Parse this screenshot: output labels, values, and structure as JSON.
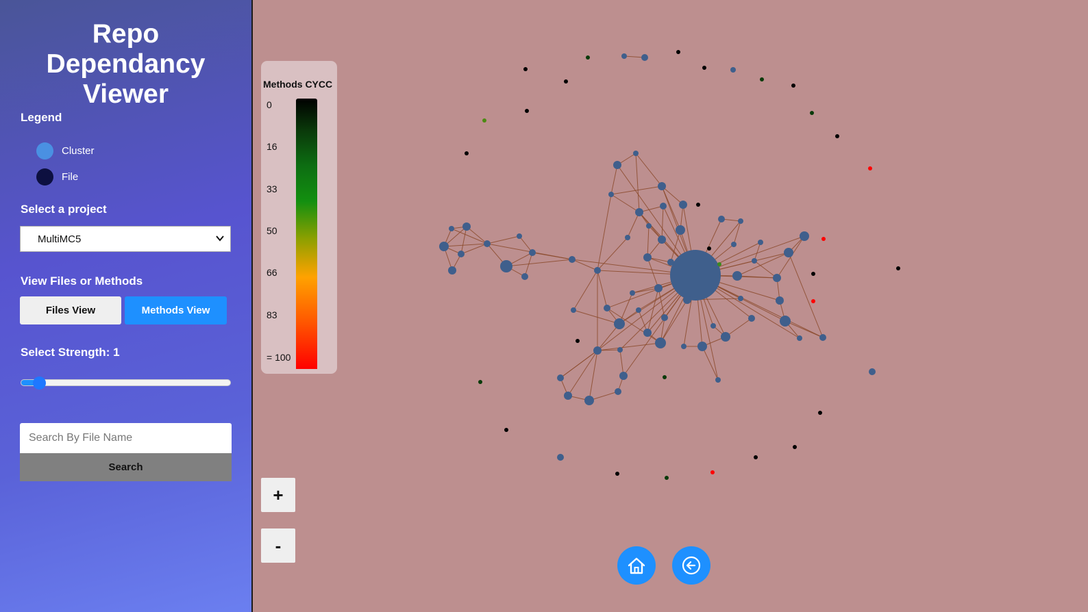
{
  "sidebar": {
    "title_lines": [
      "Repo",
      "Dependancy",
      "Viewer"
    ],
    "legend": {
      "title": "Legend",
      "items": [
        {
          "label": "Cluster",
          "color": "#4a90e2"
        },
        {
          "label": "File",
          "color": "#0d1040"
        }
      ]
    },
    "project": {
      "label": "Select a project",
      "selected": "MultiMC5"
    },
    "view": {
      "label": "View Files or Methods",
      "files_button": "Files View",
      "methods_button": "Methods View",
      "active": "Methods View"
    },
    "strength": {
      "label": "Select Strength: 1",
      "value": 1,
      "fraction": 0.06
    },
    "search": {
      "placeholder": "Search By File Name",
      "value": "",
      "button": "Search"
    }
  },
  "colorbar": {
    "title": "Methods CYCC",
    "ticks": [
      "0",
      "16",
      "33",
      "50",
      "66",
      "83",
      "= 100"
    ]
  },
  "controls": {
    "zoom_in": "+",
    "zoom_out": "-",
    "home_icon": "home-icon",
    "back_icon": "arrow-left-circle-icon"
  },
  "colors": {
    "background": "#bd8f8f",
    "node": "#3f5f8c",
    "edge": "#8b4a2b",
    "accent": "#1e90ff"
  }
}
